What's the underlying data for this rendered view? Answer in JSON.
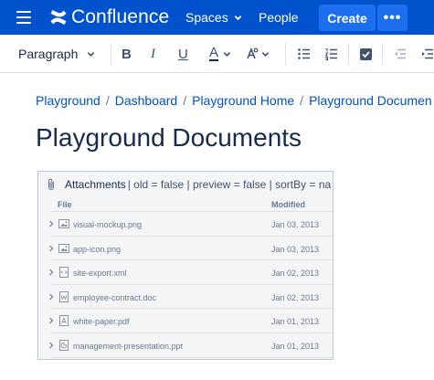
{
  "topnav": {
    "logo_text": "Confluence",
    "spaces_label": "Spaces",
    "people_label": "People",
    "create_label": "Create",
    "more_label": "•••",
    "bg_color": "#0052cc"
  },
  "toolbar": {
    "paragraph_label": "Paragraph",
    "bold_label": "B",
    "italic_label": "I",
    "underline_label": "U",
    "text_color_label": "A"
  },
  "breadcrumb": {
    "items": [
      "Playground",
      "Dashboard",
      "Playground Home",
      "Playground Documen"
    ]
  },
  "page": {
    "title": "Playground Documents"
  },
  "attachments": {
    "macro_name": "Attachments",
    "params": "| old = false | preview = false | sortBy = na",
    "columns": {
      "file": "File",
      "modified": "Modified"
    },
    "rows": [
      {
        "name": "visual-mockup.png",
        "date": "Jan 03, 2013",
        "icon": "image-file-icon"
      },
      {
        "name": "app-icon.png",
        "date": "Jan 03, 2013",
        "icon": "image-file-icon"
      },
      {
        "name": "site-export.xml",
        "date": "Jan 02, 2013",
        "icon": "code-file-icon"
      },
      {
        "name": "employee-contract.doc",
        "date": "Jan 02, 2013",
        "icon": "word-file-icon"
      },
      {
        "name": "white-paper.pdf",
        "date": "Jan 01, 2013",
        "icon": "pdf-file-icon"
      },
      {
        "name": "management-presentation.ppt",
        "date": "Jan 01, 2013",
        "icon": "presentation-file-icon"
      }
    ]
  }
}
